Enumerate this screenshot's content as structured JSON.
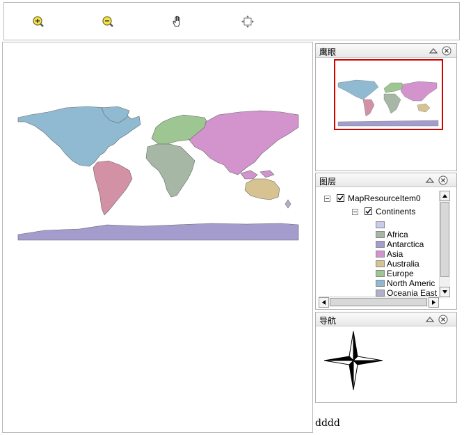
{
  "toolbar": {
    "tools": [
      {
        "name": "zoom-in",
        "icon": "zoom-in-icon"
      },
      {
        "name": "zoom-out",
        "icon": "zoom-out-icon"
      },
      {
        "name": "pan",
        "icon": "hand-icon"
      },
      {
        "name": "full-extent",
        "icon": "full-extent-icon"
      }
    ]
  },
  "overview_panel": {
    "title": "鹰眼",
    "collapse_icon": "collapse-up-icon",
    "close_icon": "close-icon"
  },
  "layers_panel": {
    "title": "图层",
    "resource": {
      "label": "MapResourceItem0",
      "checked": true
    },
    "layer": {
      "label": "Continents",
      "checked": true
    },
    "legend": [
      {
        "label": "",
        "color": "#c8cbec"
      },
      {
        "label": "Africa",
        "color": "#a6b8a5"
      },
      {
        "label": "Antarctica",
        "color": "#a39ccc"
      },
      {
        "label": "Asia",
        "color": "#d393cd"
      },
      {
        "label": "Australia",
        "color": "#d7c392"
      },
      {
        "label": "Europe",
        "color": "#9dc692"
      },
      {
        "label": "North Americ",
        "color": "#8fbad1"
      },
      {
        "label": "Oceania East",
        "color": "#b0b0c8"
      }
    ]
  },
  "navigation_panel": {
    "title": "导航",
    "compass_icon": "compass-rose-icon"
  },
  "footer": {
    "text": "dddd"
  },
  "colors": {
    "north_america": "#8fbad1",
    "south_america": "#d391a6",
    "europe": "#9dc692",
    "africa": "#a6b8a5",
    "asia": "#d393cd",
    "australia": "#d7c392",
    "antarctica": "#a39ccc",
    "overview_frame": "#d40000"
  }
}
